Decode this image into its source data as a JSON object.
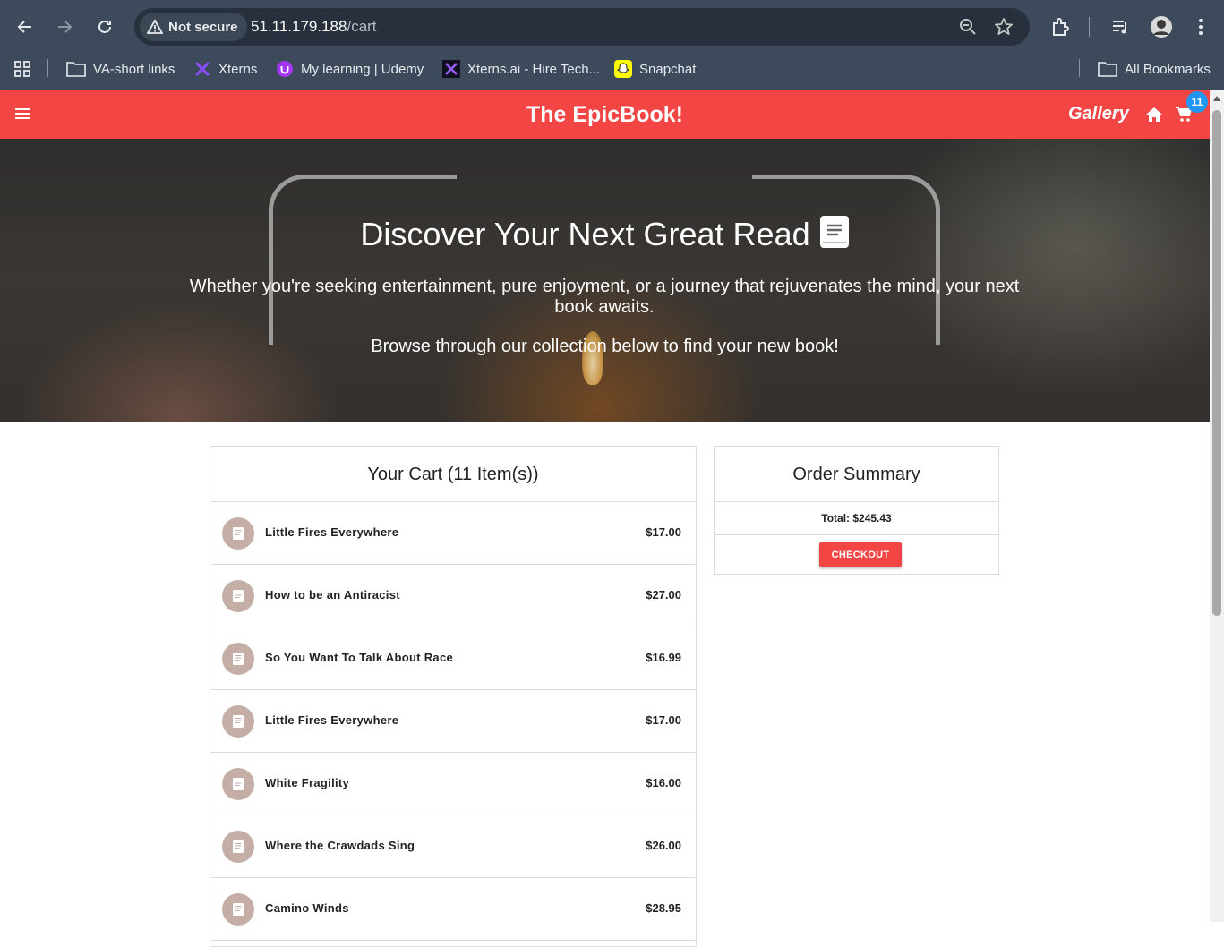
{
  "browser": {
    "security_label": "Not secure",
    "url_host": "51.11.179.188",
    "url_path": "/cart",
    "bookmarks": [
      {
        "label": "VA-short links",
        "icon": "folder-icon"
      },
      {
        "label": "Xterns",
        "icon": "xterns-icon"
      },
      {
        "label": "My learning | Udemy",
        "icon": "udemy-icon"
      },
      {
        "label": "Xterns.ai - Hire Tech...",
        "icon": "xterns-ai-icon"
      },
      {
        "label": "Snapchat",
        "icon": "snapchat-icon"
      }
    ],
    "all_bookmarks": "All Bookmarks"
  },
  "header": {
    "brand": "The EpicBook!",
    "gallery": "Gallery",
    "cart_count": "11",
    "color": "#f44545"
  },
  "hero": {
    "title": "Discover Your Next Great Read",
    "subtitle": "Whether you're seeking entertainment, pure enjoyment, or a journey that rejuvenates the mind, your next book awaits.",
    "browse": "Browse through our collection below to find your new book!"
  },
  "cart": {
    "title": "Your Cart (11 Item(s))",
    "items": [
      {
        "title": "Little Fires Everywhere",
        "price": "$17.00"
      },
      {
        "title": "How to be an Antiracist",
        "price": "$27.00"
      },
      {
        "title": "So You Want To Talk About Race",
        "price": "$16.99"
      },
      {
        "title": "Little Fires Everywhere",
        "price": "$17.00"
      },
      {
        "title": "White Fragility",
        "price": "$16.00"
      },
      {
        "title": "Where the Crawdads Sing",
        "price": "$26.00"
      },
      {
        "title": "Camino Winds",
        "price": "$28.95"
      }
    ]
  },
  "summary": {
    "title": "Order Summary",
    "total": "Total: $245.43",
    "checkout": "CHECKOUT"
  }
}
